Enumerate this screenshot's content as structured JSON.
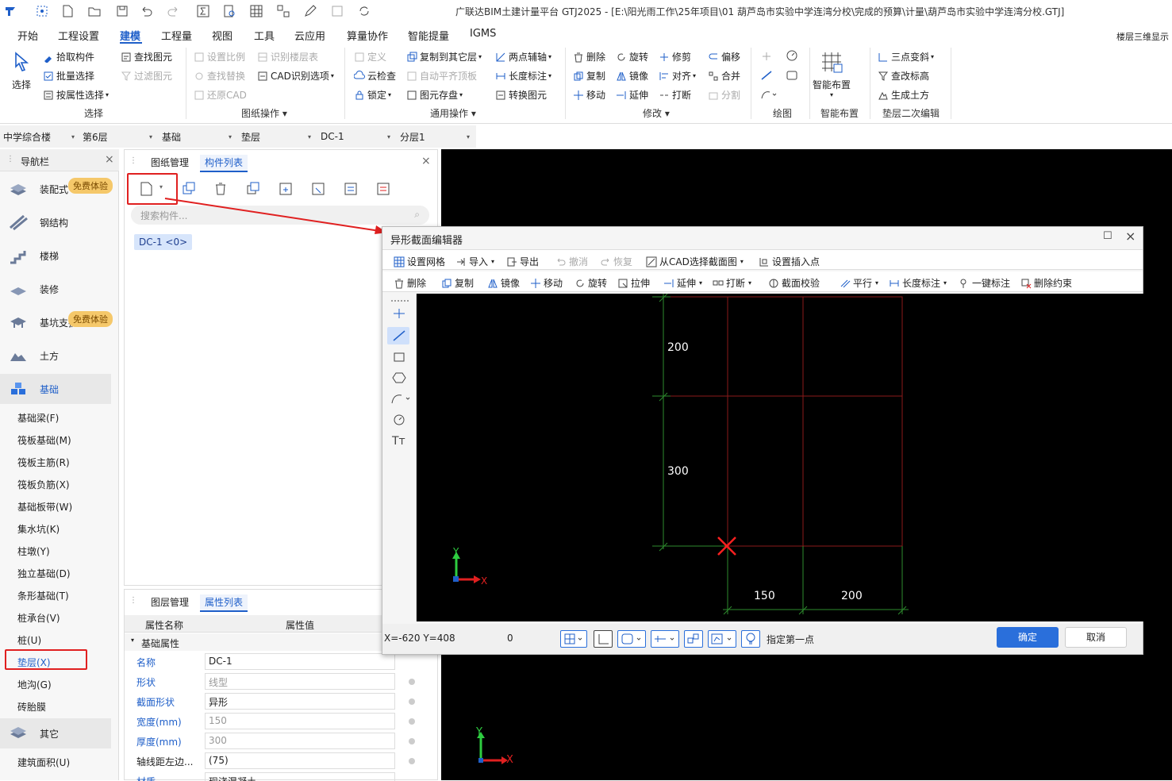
{
  "title": "广联达BIM土建计量平台 GTJ2025 - [E:\\阳光雨工作\\25年项目\\01 葫芦岛市实验中学连湾分校\\完成的预算\\计量\\葫芦岛市实验中学连湾分校.GTJ]",
  "menu": [
    "开始",
    "工程设置",
    "建模",
    "工程量",
    "视图",
    "工具",
    "云应用",
    "算量协作",
    "智能提量",
    "IGMS"
  ],
  "menu_right": "楼层三维显示",
  "ribbon": {
    "select": {
      "label": "选择",
      "pick": "拾取构件",
      "batch": "批量选择",
      "by_attr": "按属性选择",
      "find": "查找图元",
      "filter": "过滤图元",
      "group": "选择"
    },
    "drawing": {
      "scale": "设置比例",
      "identify_floor": "识别楼层表",
      "find_replace": "查找替换",
      "cad_options": "CAD识别选项",
      "restore_cad": "还原CAD",
      "group": "图纸操作"
    },
    "common": {
      "define": "定义",
      "copy_to_floor": "复制到其它层",
      "two_point_axis": "两点辅轴",
      "cloud_check": "云检查",
      "auto_align": "自动平齐顶板",
      "length_dim": "长度标注",
      "lock": "锁定",
      "save_element": "图元存盘",
      "convert": "转换图元",
      "group": "通用操作"
    },
    "modify": {
      "delete": "删除",
      "rotate": "旋转",
      "trim": "修剪",
      "offset": "偏移",
      "copy": "复制",
      "mirror": "镜像",
      "align": "对齐",
      "merge": "合并",
      "move": "移动",
      "extend": "延伸",
      "break": "打断",
      "split": "分割",
      "group": "修改"
    },
    "draw": {
      "group": "绘图"
    },
    "smart": {
      "label": "智能布置",
      "group": "智能布置"
    },
    "cushion": {
      "three_point": "三点变斜",
      "change_elev": "查改标高",
      "gen_earth": "生成土方",
      "group": "垫层二次编辑"
    }
  },
  "dropdowns": [
    "中学综合楼",
    "第6层",
    "基础",
    "垫层",
    "DC-1",
    "分层1"
  ],
  "nav": {
    "title": "导航栏",
    "big_items": [
      "装配式",
      "钢结构",
      "楼梯",
      "装修",
      "基坑支护",
      "土方",
      "基础",
      "其它"
    ],
    "badge": "免费体验",
    "sub_items": [
      "基础梁(F)",
      "筏板基础(M)",
      "筏板主筋(R)",
      "筏板负筋(X)",
      "基础板带(W)",
      "集水坑(K)",
      "柱墩(Y)",
      "独立基础(D)",
      "条形基础(T)",
      "桩承台(V)",
      "桩(U)",
      "垫层(X)",
      "地沟(G)",
      "砖胎膜"
    ],
    "bottom_item": "建筑面积(U)"
  },
  "component_panel": {
    "tabs": [
      "图纸管理",
      "构件列表"
    ],
    "search_placeholder": "搜索构件...",
    "item": "DC-1 <0>"
  },
  "property_panel": {
    "tabs": [
      "图层管理",
      "属性列表"
    ],
    "col_name": "属性名称",
    "col_value": "属性值",
    "section": "基础属性",
    "rows": [
      {
        "name": "名称",
        "value": "DC-1"
      },
      {
        "name": "形状",
        "value": "线型"
      },
      {
        "name": "截面形状",
        "value": "异形"
      },
      {
        "name": "宽度(mm)",
        "value": "150"
      },
      {
        "name": "厚度(mm)",
        "value": "300"
      },
      {
        "name": "轴线距左边...",
        "value": "(75)"
      },
      {
        "name": "材质",
        "value": "现浇混凝土"
      }
    ]
  },
  "dialog": {
    "title": "异形截面编辑器",
    "toolbar1": [
      "设置网格",
      "导入",
      "导出",
      "撤消",
      "恢复",
      "从CAD选择截面图",
      "设置插入点"
    ],
    "toolbar2": [
      "删除",
      "复制",
      "镜像",
      "移动",
      "旋转",
      "拉伸",
      "延伸",
      "打断",
      "截面校验",
      "平行",
      "长度标注",
      "一键标注",
      "删除约束"
    ],
    "dims": {
      "h1": "200",
      "h2": "300",
      "w1": "150",
      "w2": "200"
    },
    "coords": "X=-620 Y=408",
    "zero": "0",
    "status": "指定第一点",
    "ok": "确定",
    "cancel": "取消"
  },
  "axis": {
    "x": "X",
    "y": "Y"
  }
}
